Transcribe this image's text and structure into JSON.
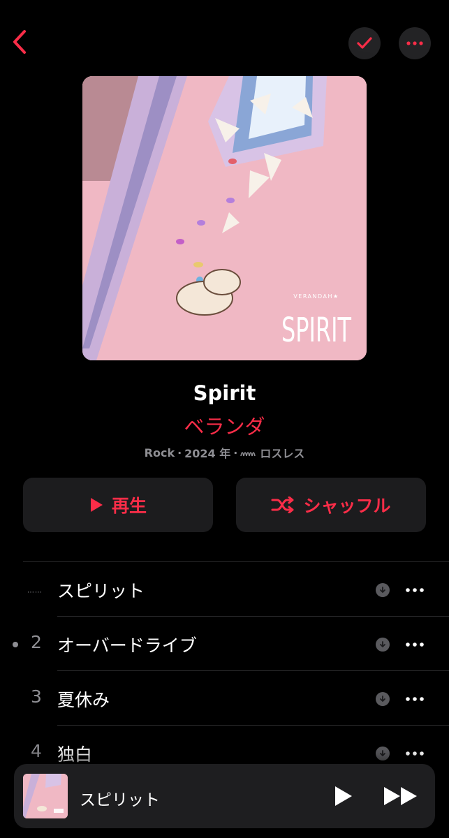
{
  "header": {
    "back_icon": "chevron-left-icon",
    "library_icon": "checkmark-icon",
    "more_icon": "ellipsis-icon"
  },
  "album": {
    "art_text_brand": "VERANDAH★",
    "art_text_title": "SPIRIT",
    "title": "Spirit",
    "artist": "ベランダ",
    "genre": "Rock",
    "separator": "·",
    "year": "2024 年",
    "quality_icon": "lossless-icon",
    "quality": "ロスレス"
  },
  "actions": {
    "play_label": "再生",
    "shuffle_label": "シャッフル"
  },
  "tracks": [
    {
      "number": "",
      "title": "スピリット",
      "playing": true
    },
    {
      "number": "2",
      "title": "オーバードライブ",
      "playing": false
    },
    {
      "number": "3",
      "title": "夏休み",
      "playing": false
    },
    {
      "number": "4",
      "title": "独白",
      "playing": false
    }
  ],
  "miniplayer": {
    "title": "スピリット",
    "play_icon": "play-icon",
    "forward_icon": "fast-forward-icon"
  },
  "colors": {
    "accent": "#fa2d48",
    "background": "#000000",
    "secondary_text": "#8e8e93"
  }
}
